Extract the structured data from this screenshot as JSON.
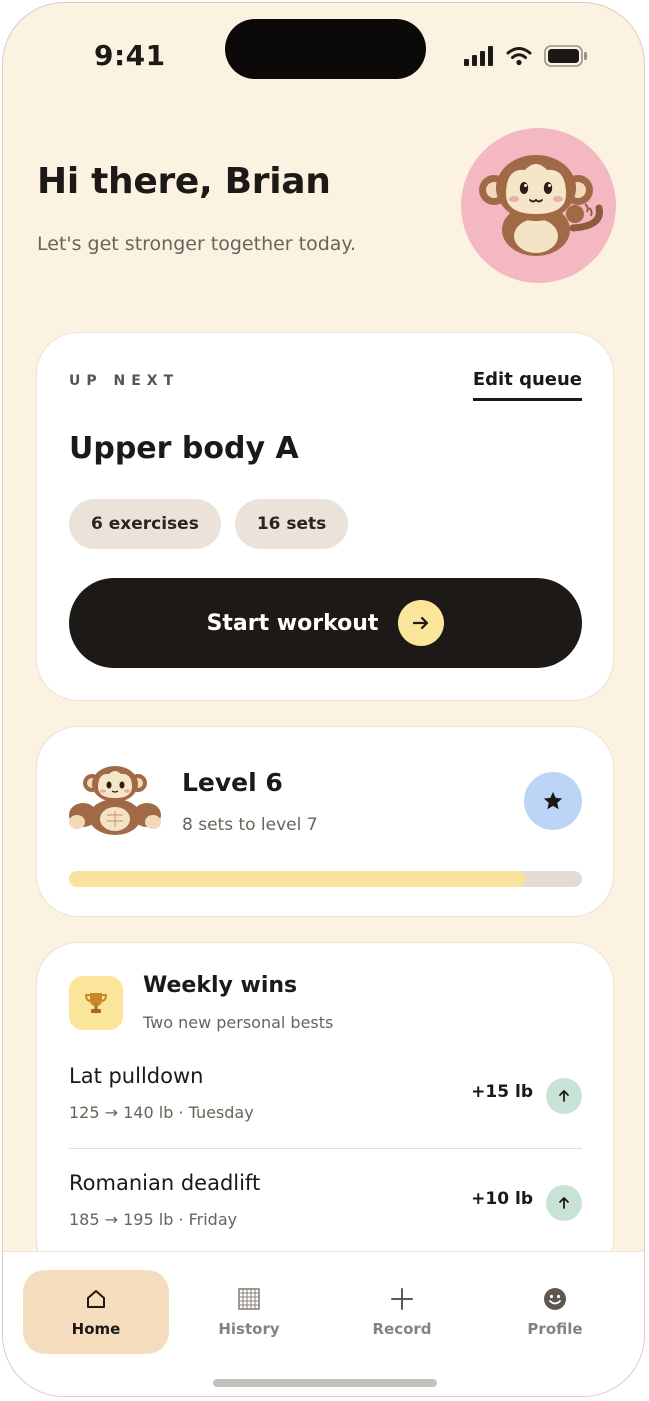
{
  "status_bar": {
    "time": "9:41"
  },
  "header": {
    "greeting": "Hi there, Brian",
    "subline": "Let's get stronger together today.",
    "avatar_icon": "monkey-mascot-icon"
  },
  "up_next": {
    "eyebrow": "UP NEXT",
    "edit_label": "Edit queue",
    "title": "Upper body A",
    "chips": [
      "6 exercises",
      "16 sets"
    ],
    "start_label": "Start workout"
  },
  "level": {
    "title": "Level 6",
    "subtitle": "8 sets to level 7",
    "progress": 0.89,
    "badge_icon": "star-icon"
  },
  "weekly_wins": {
    "title": "Weekly wins",
    "subtitle": "Two new personal bests",
    "icon": "trophy-icon",
    "items": [
      {
        "name": "Lat pulldown",
        "detail": "125 → 140 lb · Tuesday",
        "delta": "+15 lb"
      },
      {
        "name": "Romanian deadlift",
        "detail": "185 → 195 lb · Friday",
        "delta": "+10 lb"
      }
    ]
  },
  "tabs": [
    {
      "label": "Home",
      "icon": "home-icon",
      "active": true
    },
    {
      "label": "History",
      "icon": "calendar-grid-icon",
      "active": false
    },
    {
      "label": "Record",
      "icon": "plus-icon",
      "active": false
    },
    {
      "label": "Profile",
      "icon": "smiley-icon",
      "active": false
    }
  ],
  "colors": {
    "background": "#fcf2e1",
    "ink": "#1c1917",
    "accent_yellow": "#fbe59a",
    "avatar_pink": "#f3b8c2",
    "badge_blue": "#bcd5f7",
    "badge_green": "#c8e3d5",
    "tab_active": "#f5dcbd"
  }
}
